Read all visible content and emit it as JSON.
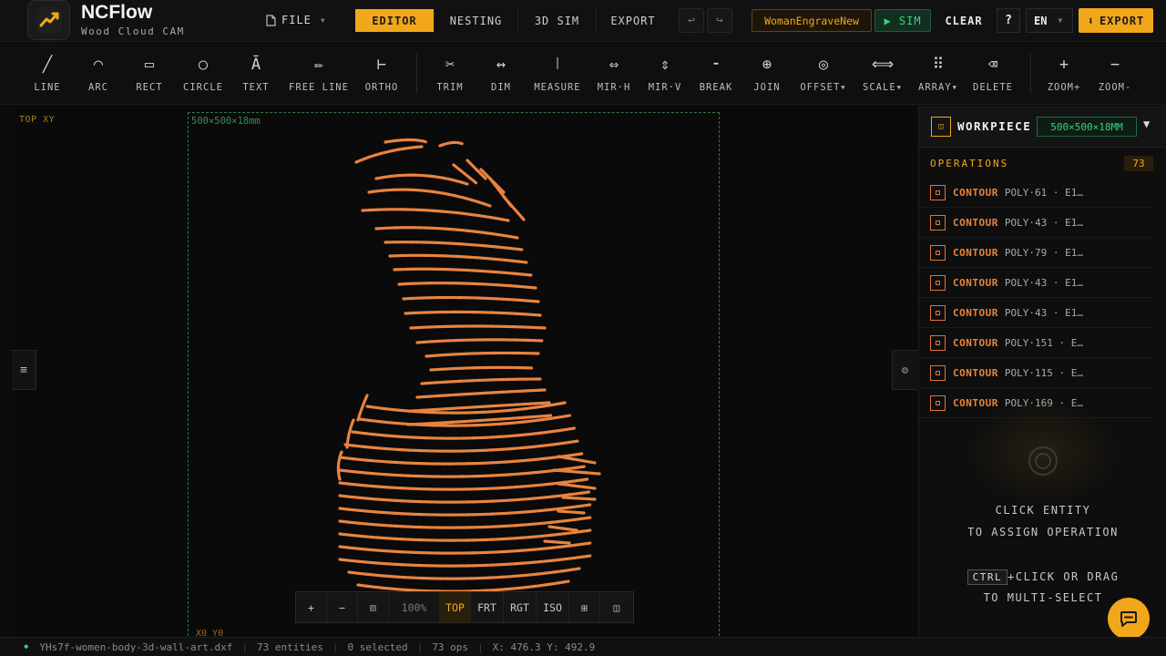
{
  "app": {
    "title": "NCFlow",
    "subtitle": "Wood Cloud CAM"
  },
  "header": {
    "file_menu": "FILE",
    "tabs": [
      {
        "label": "EDITOR",
        "active": true
      },
      {
        "label": "NESTING",
        "active": false
      },
      {
        "label": "3D SIM",
        "active": false
      },
      {
        "label": "EXPORT",
        "active": false
      }
    ],
    "undo_icon": "↩",
    "redo_icon": "↪",
    "file_name": "WomanEngraveNew",
    "sim_label": "▶ SIM",
    "clear_label": "CLEAR",
    "help_label": "?",
    "language": "EN",
    "export_label": "EXPORT",
    "export_icon": "⬇"
  },
  "toolbar": {
    "tools": [
      {
        "label": "LINE",
        "icon": "╱",
        "name": "line-tool",
        "icon_name": "line-icon"
      },
      {
        "label": "ARC",
        "icon": "◠",
        "name": "arc-tool",
        "icon_name": "arc-icon"
      },
      {
        "label": "RECT",
        "icon": "▭",
        "name": "rect-tool",
        "icon_name": "rect-icon"
      },
      {
        "label": "CIRCLE",
        "icon": "○",
        "name": "circle-tool",
        "icon_name": "circle-icon"
      },
      {
        "label": "TEXT",
        "icon": "Ā",
        "name": "text-tool",
        "icon_name": "text-icon"
      },
      {
        "label": "FREE LINE",
        "icon": "✏",
        "name": "free-line-tool",
        "icon_name": "pencil-icon"
      },
      {
        "label": "ORTHO",
        "icon": "⊢",
        "name": "ortho-tool",
        "icon_name": "ortho-icon"
      },
      {
        "label": "TRIM",
        "icon": "✂",
        "name": "trim-tool",
        "icon_name": "scissors-icon"
      },
      {
        "label": "DIM",
        "icon": "↔",
        "name": "dim-tool",
        "icon_name": "dimension-icon"
      },
      {
        "label": "MEASURE",
        "icon": "⦚",
        "name": "measure-tool",
        "icon_name": "measure-icon"
      },
      {
        "label": "MIR·H",
        "icon": "⇔",
        "name": "mirror-h-tool",
        "icon_name": "mirror-horizontal-icon"
      },
      {
        "label": "MIR·V",
        "icon": "⇕",
        "name": "mirror-v-tool",
        "icon_name": "mirror-vertical-icon"
      },
      {
        "label": "BREAK",
        "icon": "⁃",
        "name": "break-tool",
        "icon_name": "break-icon"
      },
      {
        "label": "JOIN",
        "icon": "⊕",
        "name": "join-tool",
        "icon_name": "join-icon"
      },
      {
        "label": "OFFSET▾",
        "icon": "◎",
        "name": "offset-tool",
        "icon_name": "offset-icon"
      },
      {
        "label": "SCALE▾",
        "icon": "⟺",
        "name": "scale-tool",
        "icon_name": "scale-icon"
      },
      {
        "label": "ARRAY▾",
        "icon": "⠿",
        "name": "array-tool",
        "icon_name": "array-icon"
      },
      {
        "label": "DELETE",
        "icon": "⌫",
        "name": "delete-tool",
        "icon_name": "delete-icon"
      },
      {
        "label": "ZOOM+",
        "icon": "+",
        "name": "zoom-in-tool",
        "icon_name": "zoom-in-icon"
      },
      {
        "label": "ZOOM-",
        "icon": "−",
        "name": "zoom-out-tool",
        "icon_name": "zoom-out-icon"
      }
    ]
  },
  "canvas": {
    "view_label": "TOP XY",
    "workpiece_dims": "500×500×18mm",
    "origin_label": "X0 Y0",
    "stroke_color": "#e0824a",
    "view_controls": [
      {
        "label": "+",
        "name": "zoom-in-button"
      },
      {
        "label": "−",
        "name": "zoom-out-button"
      },
      {
        "label": "⊡",
        "name": "fit-view-button"
      },
      {
        "label": "100%",
        "name": "zoom-level"
      },
      {
        "label": "TOP",
        "name": "view-top-button"
      },
      {
        "label": "FRT",
        "name": "view-front-button"
      },
      {
        "label": "RGT",
        "name": "view-right-button"
      },
      {
        "label": "ISO",
        "name": "view-iso-button"
      },
      {
        "label": "⊞",
        "name": "grid-toggle-button"
      },
      {
        "label": "◫",
        "name": "layout-toggle-button"
      }
    ],
    "left_toggle_icon": "≡",
    "right_toggle_icon": "⚙"
  },
  "panel": {
    "workpiece_title": "WORKPIECE",
    "workpiece_size": "500×500×18MM",
    "workpiece_caret": "▼",
    "operations_title": "OPERATIONS",
    "operations_count": "73",
    "operations": [
      {
        "type": "CONTOUR",
        "name": "POLY·61 · E1…"
      },
      {
        "type": "CONTOUR",
        "name": "POLY·43 · E1…"
      },
      {
        "type": "CONTOUR",
        "name": "POLY·79 · E1…"
      },
      {
        "type": "CONTOUR",
        "name": "POLY·43 · E1…"
      },
      {
        "type": "CONTOUR",
        "name": "POLY·43 · E1…"
      },
      {
        "type": "CONTOUR",
        "name": "POLY·151 · E…"
      },
      {
        "type": "CONTOUR",
        "name": "POLY·115 · E…"
      },
      {
        "type": "CONTOUR",
        "name": "POLY·169 · E…"
      }
    ],
    "hint_line1": "CLICK ENTITY",
    "hint_line2": "TO ASSIGN OPERATION",
    "hint_kbd": "CTRL",
    "hint_line3": "+CLICK OR DRAG",
    "hint_line4": "TO MULTI-SELECT"
  },
  "status": {
    "file": "YHs7f-women-body-3d-wall-art.dxf",
    "entities": "73 entities",
    "selected": "0 selected",
    "ops": "73 ops",
    "coords": "X: 476.3 Y: 492.9"
  },
  "colors": {
    "accent": "#f2a71b",
    "success": "#3fcf7a",
    "contour": "#e8843f"
  }
}
